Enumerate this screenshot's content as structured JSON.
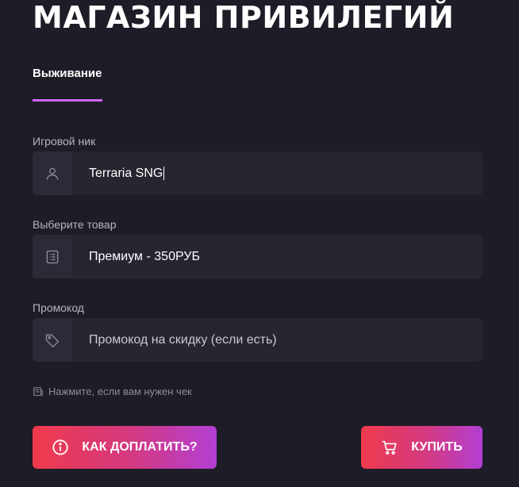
{
  "header": {
    "title": "МАГАЗИН ПРИВИЛЕГИЙ"
  },
  "tabs": [
    {
      "label": "Выживание",
      "active": true
    }
  ],
  "form": {
    "nickname": {
      "label": "Игровой ник",
      "value": "Terraria SNG",
      "icon": "user-icon"
    },
    "product": {
      "label": "Выберите товар",
      "value": "Премиум - 350РУБ",
      "icon": "list-icon"
    },
    "promo": {
      "label": "Промокод",
      "placeholder": "Промокод на скидку (если есть)",
      "icon": "tag-icon"
    }
  },
  "receipt": {
    "text": "Нажмите, если вам нужен чек",
    "icon": "receipt-icon"
  },
  "buttons": {
    "how_to_pay": {
      "label": "КАК ДОПЛАТИТЬ?",
      "icon": "info-icon"
    },
    "buy": {
      "label": "КУПИТЬ",
      "icon": "cart-icon"
    }
  },
  "colors": {
    "background": "#1d1c27",
    "field_bg": "#262530",
    "accent_tab": "#d066f0",
    "gradient_start": "#ef3a4c",
    "gradient_end": "#b23fd4"
  }
}
